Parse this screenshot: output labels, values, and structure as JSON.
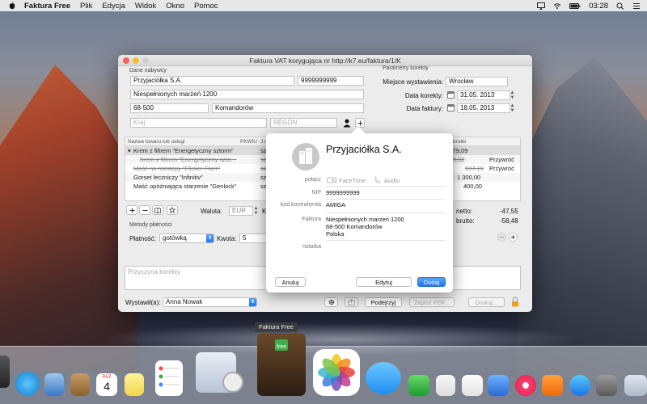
{
  "menubar": {
    "app": "Faktura Free",
    "items": [
      "Plik",
      "Edycja",
      "Widok",
      "Okno",
      "Pomoc"
    ],
    "clock": "03:28"
  },
  "window": {
    "title": "Faktura VAT korygująca nr http://k7.eu/faktura/1/K",
    "buyer": {
      "section": "Dane nabywcy",
      "name": "Przyjaciółka S.A.",
      "nip": "9999999999",
      "street": "Niespełnionych marzeń 1200",
      "zip": "68-500",
      "city": "Komandorów",
      "country_placeholder": "Kraj",
      "regon_placeholder": "REGON"
    },
    "params": {
      "section": "Parametry korekty",
      "place_label": "Miejsce wystawienia:",
      "place": "Wrocław",
      "corr_date_label": "Data korekty:",
      "corr_date": "31.05. 2013",
      "inv_date_label": "Data faktury:",
      "inv_date": "18.05. 2013"
    },
    "table": {
      "col_name": "Nazwa towaru lub usługi",
      "col_pkwiu": "PKWiU",
      "col_jm": "J.m.",
      "col_brutto": "ość brutto",
      "rows": [
        {
          "name": "Krem z filtrem \"Energetyczny sztorm\"",
          "mid": "szt",
          "value": "83 779,09",
          "action": ""
        },
        {
          "name": "Krem z filtrem \"Energetyczny szto…",
          "mid": "szt",
          "value": "83 640,38",
          "action": "Przywróć"
        },
        {
          "name": "Maść na rozstępy \"Flicker Fixer\"",
          "mid": "szt",
          "value": "597,19",
          "action": "Przywróć"
        },
        {
          "name": "Gorset leczniczy \"Infinitiv\"",
          "mid": "szt",
          "value": "1 300,00",
          "action": ""
        },
        {
          "name": "Maść opóźniająca starzenie \"Genlock\"",
          "mid": "szt",
          "value": "400,00",
          "action": ""
        }
      ]
    },
    "currency_label": "Waluta:",
    "currency": "EUR",
    "ku_label": "Ku",
    "netto_label": "netto:",
    "netto": "-47,55",
    "brutto_label": "brutto:",
    "brutto": "-58,48",
    "payment_section": "Metody płatności",
    "payment_label": "Płatność:",
    "payment": "gotówką",
    "amount_label": "Kwota:",
    "amount": "5",
    "reason_placeholder": "Przyczyna korekty",
    "issuer_label": "Wystawił(a):",
    "issuer": "Anna Nowak",
    "preview_btn": "Podejrzyj",
    "save_pdf_btn": "Zapisz PDF...",
    "print_btn": "Drukuj..."
  },
  "popover": {
    "name": "Przyjaciółka S.A.",
    "connect_label": "połącz",
    "facetime": "FaceTime",
    "audio": "Audio",
    "nip_label": "NIP",
    "nip": "9999999999",
    "code_label": "kod kontrahenta",
    "code": "AMIGA",
    "invoice_label": "Faktura",
    "address": "Niespełnionych marzeń 1200\n68-500 Komandorów\nPolska",
    "note_label": "notatka",
    "cancel": "Anuluj",
    "edit": "Edytuj",
    "add": "Dodaj"
  },
  "tooltip": "Faktura Free",
  "dock": {
    "calendar_month": "PAŹ",
    "calendar_day": "4"
  }
}
